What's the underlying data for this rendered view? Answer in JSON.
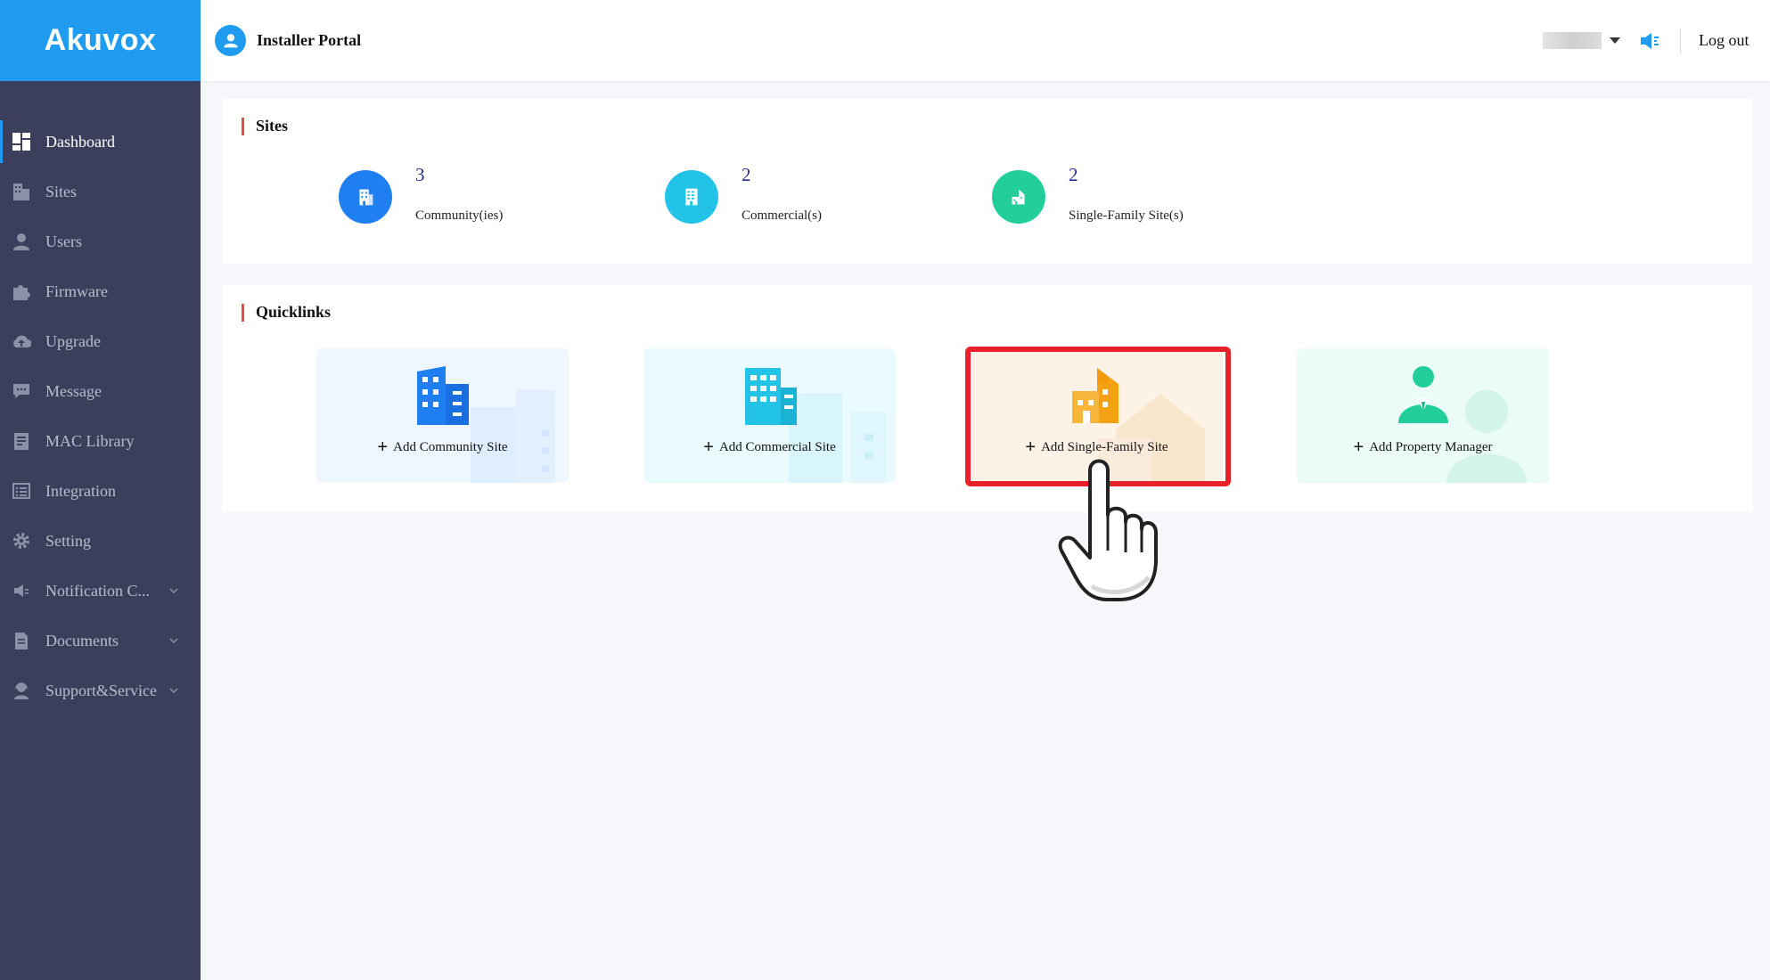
{
  "brand": {
    "logo_text": "Akuvox",
    "accent": "#1f9cf0",
    "sidebar_bg": "#3b3f5c"
  },
  "header": {
    "portal_title": "Installer Portal",
    "logout_label": "Log out",
    "icons": {
      "user": "user-avatar-icon",
      "language": "language-dropdown",
      "notice": "speaker-icon"
    }
  },
  "sidebar": {
    "items": [
      {
        "label": "Dashboard",
        "icon": "dashboard-icon",
        "active": true
      },
      {
        "label": "Sites",
        "icon": "building-icon"
      },
      {
        "label": "Users",
        "icon": "user-icon"
      },
      {
        "label": "Firmware",
        "icon": "puzzle-icon"
      },
      {
        "label": "Upgrade",
        "icon": "cloud-upload-icon"
      },
      {
        "label": "Message",
        "icon": "message-icon"
      },
      {
        "label": "MAC Library",
        "icon": "book-icon"
      },
      {
        "label": "Integration",
        "icon": "list-icon"
      },
      {
        "label": "Setting",
        "icon": "gear-icon"
      },
      {
        "label": "Notification C...",
        "icon": "speaker-icon",
        "expandable": true
      },
      {
        "label": "Documents",
        "icon": "document-icon",
        "expandable": true
      },
      {
        "label": "Support&Service",
        "icon": "headset-icon",
        "expandable": true
      }
    ]
  },
  "sites": {
    "title": "Sites",
    "stats": [
      {
        "count": "3",
        "label": "Community(ies)",
        "color": "#1f7ff0"
      },
      {
        "count": "2",
        "label": "Commercial(s)",
        "color": "#22c3e6"
      },
      {
        "count": "2",
        "label": "Single-Family Site(s)",
        "color": "#22cf9a"
      }
    ]
  },
  "quicklinks": {
    "title": "Quicklinks",
    "items": [
      {
        "label": "Add Community Site",
        "bg": "#eef6ff",
        "color": "#1f7ff0"
      },
      {
        "label": "Add Commercial Site",
        "bg": "#e9fbff",
        "color": "#22c3e6"
      },
      {
        "label": "Add Single-Family Site",
        "bg": "#fcf3e6",
        "color": "#f5a114",
        "highlighted": true
      },
      {
        "label": "Add Property Manager",
        "bg": "#eafcf5",
        "color": "#22cf9a"
      }
    ]
  },
  "annotation": {
    "highlight_color": "#e8202a",
    "target": "Add Single-Family Site"
  }
}
